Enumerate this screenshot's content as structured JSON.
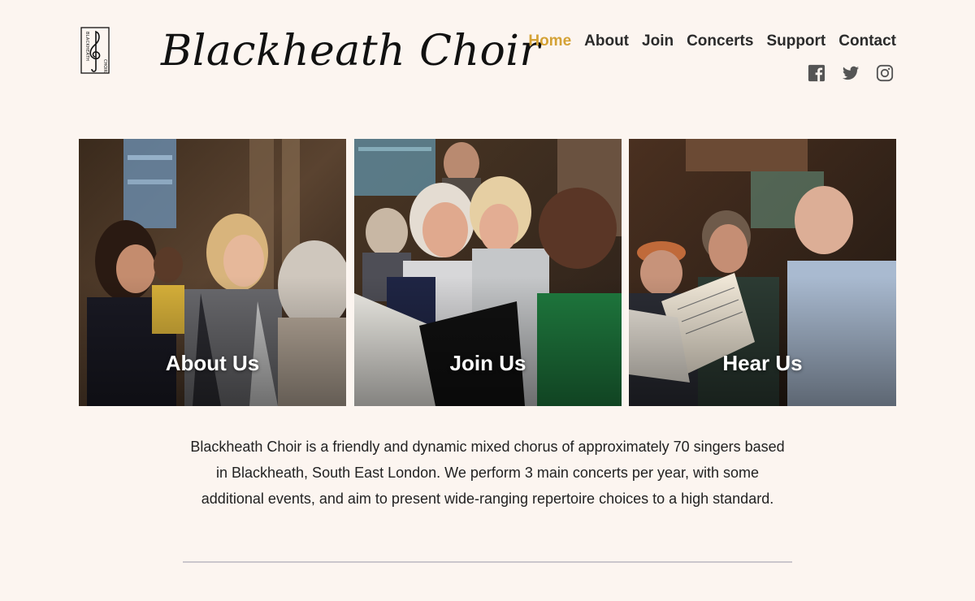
{
  "site": {
    "title": "Blackheath Choir",
    "logo_text": "BLACKHEATH CHOIR"
  },
  "nav": {
    "items": [
      {
        "label": "Home",
        "active": true
      },
      {
        "label": "About",
        "active": false
      },
      {
        "label": "Join",
        "active": false
      },
      {
        "label": "Concerts",
        "active": false
      },
      {
        "label": "Support",
        "active": false
      },
      {
        "label": "Contact",
        "active": false
      }
    ]
  },
  "social": {
    "icons": [
      "facebook-icon",
      "twitter-icon",
      "instagram-icon"
    ]
  },
  "cards": [
    {
      "label": "About Us"
    },
    {
      "label": "Join Us"
    },
    {
      "label": "Hear Us"
    }
  ],
  "intro": {
    "text": "Blackheath Choir is a friendly and dynamic mixed chorus of approximately 70 singers based in Blackheath, South East London. We perform 3 main concerts per year, with some additional events, and aim to present wide-ranging repertoire choices to a high standard."
  },
  "colors": {
    "background": "#fcf5f0",
    "accent": "#d4a236",
    "text": "#2b2b2b",
    "divider": "#cac6cc"
  }
}
